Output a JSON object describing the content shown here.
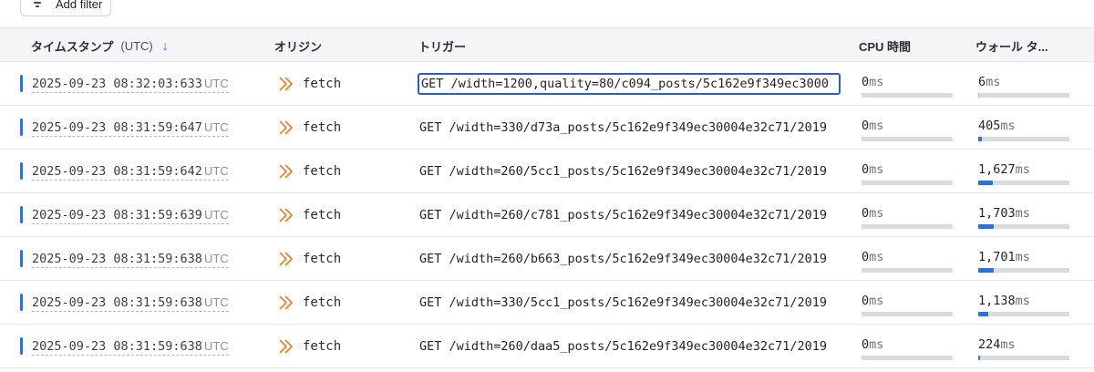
{
  "toolbar": {
    "add_filter_label": "Add filter"
  },
  "columns": {
    "timestamp": "タイムスタンプ",
    "timestamp_tz": "(UTC)",
    "origin": "オリジン",
    "trigger": "トリガー",
    "cpu": "CPU 時間",
    "wall": "ウォール タ..."
  },
  "utc_suffix": "UTC",
  "unit_ms": "ms",
  "wall_scale_max_ms": 10000,
  "rows": [
    {
      "timestamp": "2025-09-23 08:32:03:633",
      "origin": "fetch",
      "trigger": "GET /width=1200,quality=80/c094_posts/5c162e9f349ec3000",
      "cpu": "0",
      "wall": "6",
      "wall_ms": 6
    },
    {
      "timestamp": "2025-09-23 08:31:59:647",
      "origin": "fetch",
      "trigger": "GET /width=330/d73a_posts/5c162e9f349ec30004e32c71/2019",
      "cpu": "0",
      "wall": "405",
      "wall_ms": 405
    },
    {
      "timestamp": "2025-09-23 08:31:59:642",
      "origin": "fetch",
      "trigger": "GET /width=260/5cc1_posts/5c162e9f349ec30004e32c71/2019",
      "cpu": "0",
      "wall": "1,627",
      "wall_ms": 1627
    },
    {
      "timestamp": "2025-09-23 08:31:59:639",
      "origin": "fetch",
      "trigger": "GET /width=260/c781_posts/5c162e9f349ec30004e32c71/2019",
      "cpu": "0",
      "wall": "1,703",
      "wall_ms": 1703
    },
    {
      "timestamp": "2025-09-23 08:31:59:638",
      "origin": "fetch",
      "trigger": "GET /width=260/b663_posts/5c162e9f349ec30004e32c71/2019",
      "cpu": "0",
      "wall": "1,701",
      "wall_ms": 1701
    },
    {
      "timestamp": "2025-09-23 08:31:59:638",
      "origin": "fetch",
      "trigger": "GET /width=330/5cc1_posts/5c162e9f349ec30004e32c71/2019",
      "cpu": "0",
      "wall": "1,138",
      "wall_ms": 1138
    },
    {
      "timestamp": "2025-09-23 08:31:59:638",
      "origin": "fetch",
      "trigger": "GET /width=260/daa5_posts/5c162e9f349ec30004e32c71/2019",
      "cpu": "0",
      "wall": "224",
      "wall_ms": 224
    }
  ],
  "colors": {
    "accent": "#2f6fd6",
    "fetch_icon": "#e8842c",
    "bar_track": "#d9dcdf"
  },
  "icons": {
    "filter": "filter-lines-icon",
    "sort": "arrow-down-icon",
    "origin": "fetch-chevron-icon"
  }
}
